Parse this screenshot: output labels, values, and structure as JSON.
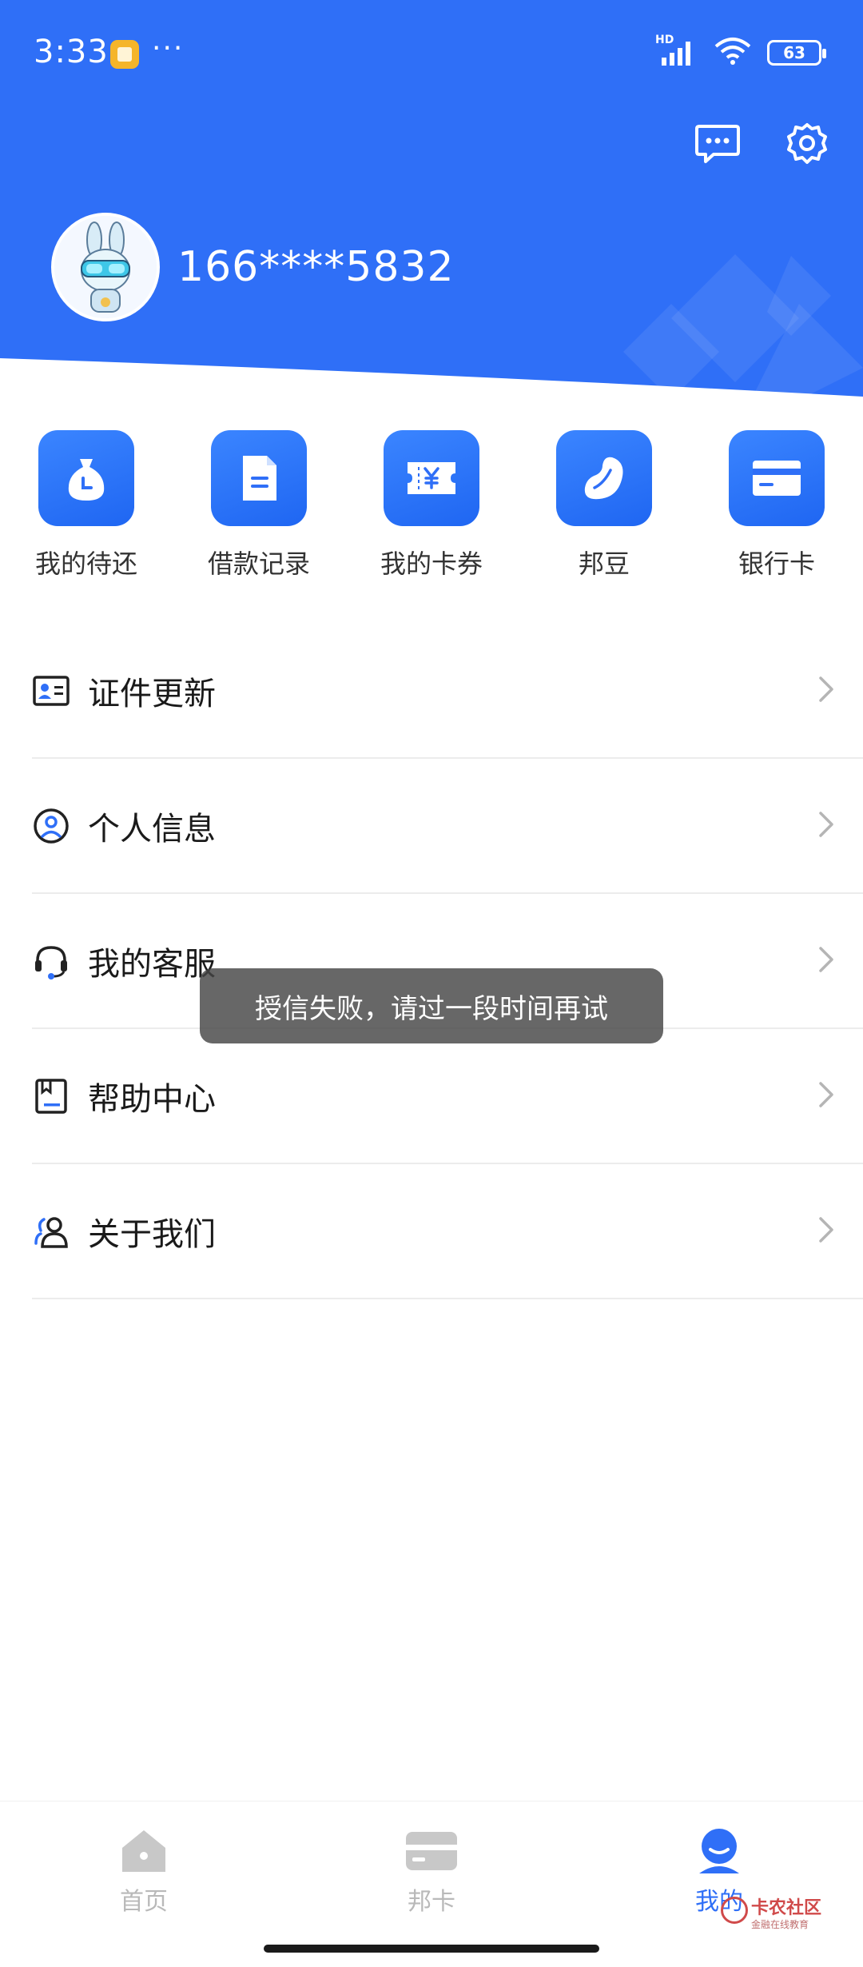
{
  "status_bar": {
    "time": "3:33",
    "dots": "···",
    "network": "HD",
    "battery": "63"
  },
  "profile": {
    "phone": "166****5832"
  },
  "quick_actions": [
    {
      "label": "我的待还",
      "icon": "money-bag-clock-icon"
    },
    {
      "label": "借款记录",
      "icon": "document-icon"
    },
    {
      "label": "我的卡券",
      "icon": "coupon-yen-icon"
    },
    {
      "label": "邦豆",
      "icon": "bean-icon"
    },
    {
      "label": "银行卡",
      "icon": "bank-card-icon"
    }
  ],
  "menu": [
    {
      "label": "证件更新",
      "icon": "id-card-icon"
    },
    {
      "label": "个人信息",
      "icon": "user-circle-icon"
    },
    {
      "label": "我的客服",
      "icon": "headset-icon"
    },
    {
      "label": "帮助中心",
      "icon": "help-book-icon"
    },
    {
      "label": "关于我们",
      "icon": "team-icon"
    }
  ],
  "toast": {
    "message": "授信失败，请过一段时间再试"
  },
  "bottom_nav": [
    {
      "label": "首页",
      "icon": "home-icon",
      "active": false
    },
    {
      "label": "邦卡",
      "icon": "card-icon",
      "active": false
    },
    {
      "label": "我的",
      "icon": "profile-icon",
      "active": true
    }
  ],
  "watermark": {
    "text": "卡农社区",
    "subtext": "金融在线教育"
  },
  "colors": {
    "brand_blue": "#2f6ff7",
    "toast_bg": "#464646",
    "inactive_nav": "#b9b9b9"
  }
}
